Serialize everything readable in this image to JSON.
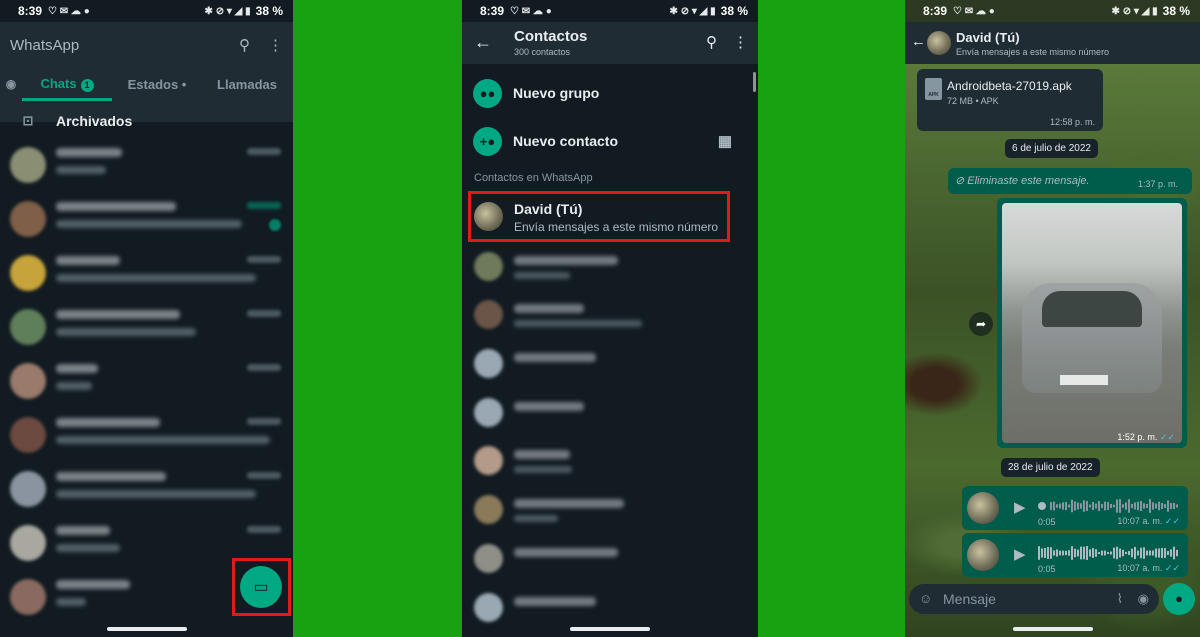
{
  "status": {
    "time": "8:39",
    "battery": "38 %"
  },
  "screen1": {
    "app_title": "WhatsApp",
    "tabs": [
      {
        "label": "Chats",
        "badge": "1"
      },
      {
        "label": "Estados •"
      },
      {
        "label": "Llamadas"
      }
    ],
    "archived_label": "Archivados",
    "fab_icon": "new-chat-icon"
  },
  "screen2": {
    "title": "Contactos",
    "subtitle": "300 contactos",
    "actions": [
      {
        "label": "Nuevo grupo",
        "icon": "group-icon"
      },
      {
        "label": "Nuevo contacto",
        "icon": "add-contact-icon"
      }
    ],
    "section_label": "Contactos en WhatsApp",
    "self_contact": {
      "name": "David (Tú)",
      "status": "Envía mensajes a este mismo número"
    }
  },
  "screen3": {
    "contact_name": "David (Tú)",
    "contact_subtitle": "Envía mensajes a este mismo número",
    "file": {
      "name": "Androidbeta-27019.apk",
      "meta": "72 MB • APK",
      "time": "12:58 p. m.",
      "icon_text": "APK"
    },
    "date1": "6 de julio de 2022",
    "deleted": {
      "text": "Eliminaste este mensaje.",
      "time": "1:37 p. m."
    },
    "photo_time": "1:52 p. m.",
    "date2": "28 de julio de 2022",
    "voice_messages": [
      {
        "duration": "0:05",
        "time": "10:07 a. m."
      },
      {
        "duration": "0:05",
        "time": "10:07 a. m."
      }
    ],
    "input_placeholder": "Mensaje"
  },
  "colors": {
    "accent": "#00a884",
    "highlight": "#e01b1b",
    "background": "#19a20f"
  }
}
